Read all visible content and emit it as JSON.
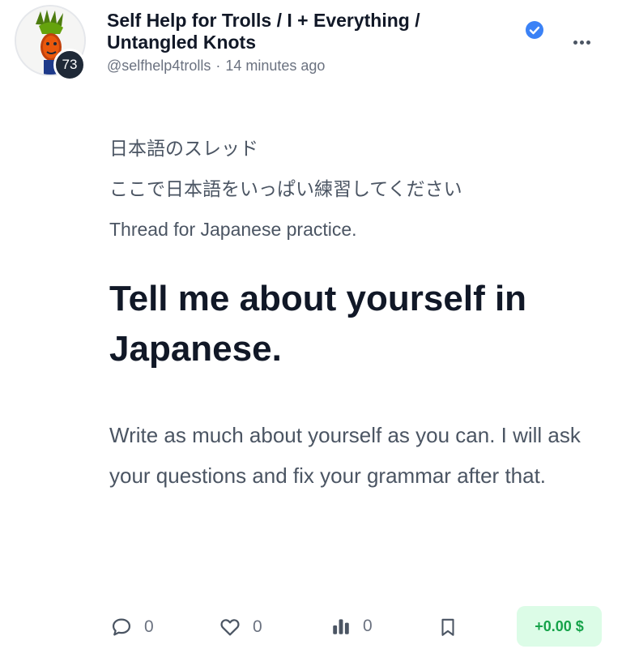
{
  "post": {
    "avatar_level": "73",
    "title": "Self Help for Trolls / I + Everything / Untangled Knots",
    "handle": "@selfhelp4trolls",
    "separator": "·",
    "time": "14 minutes ago",
    "intro_lines": [
      "日本語のスレッド",
      "ここで日本語をいっぱい練習してください",
      "Thread for Japanese practice."
    ],
    "headline": "Tell me about yourself in Japanese.",
    "body": "Write as much about yourself as you can. I will ask your questions and fix your grammar after that."
  },
  "actions": {
    "comments": "0",
    "likes": "0",
    "views": "0",
    "tip_label": "+0.00 $"
  },
  "icons": {
    "verified": "verified-check-icon",
    "more": "more-dots-icon",
    "comment": "comment-bubble-icon",
    "like": "heart-icon",
    "views": "bar-chart-icon",
    "bookmark": "bookmark-icon"
  },
  "colors": {
    "verified": "#3b82f6",
    "tip_bg": "#dcfce7",
    "tip_text": "#16a34a",
    "text_primary": "#111827",
    "text_secondary": "#4b5563"
  }
}
